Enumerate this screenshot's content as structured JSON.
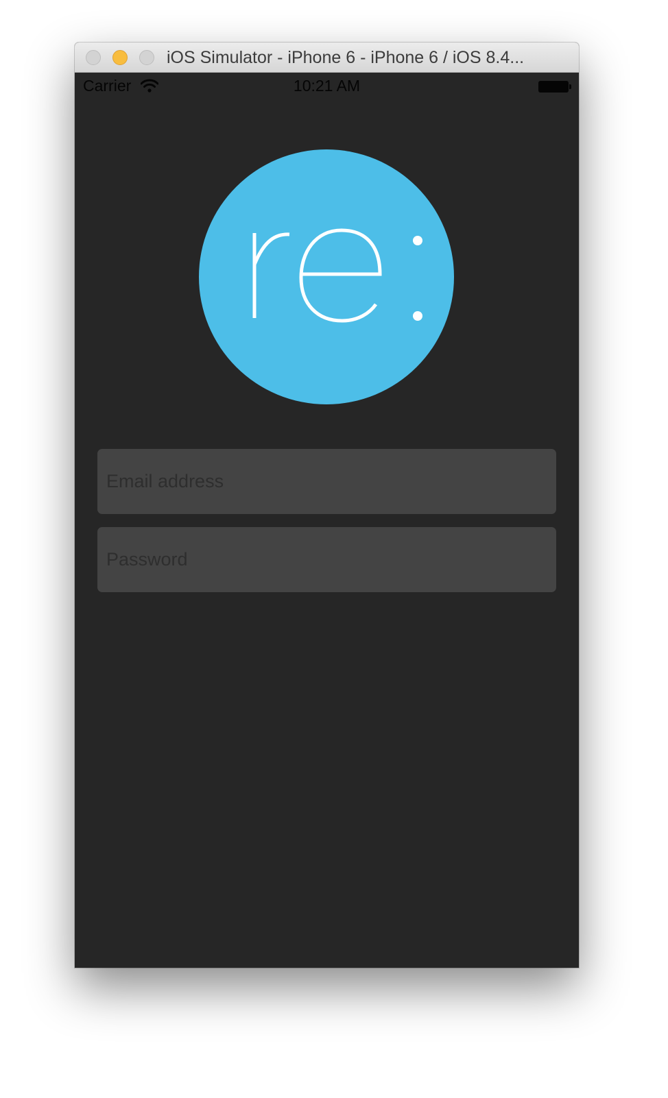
{
  "window": {
    "title": "iOS Simulator - iPhone 6 - iPhone 6 / iOS 8.4..."
  },
  "status_bar": {
    "carrier": "Carrier",
    "time": "10:21 AM",
    "icons": [
      "wifi-icon",
      "battery-icon"
    ]
  },
  "logo": {
    "text": "re:",
    "icon": "app-logo",
    "color": "#4dbee8"
  },
  "form": {
    "email": {
      "placeholder": "Email address",
      "value": ""
    },
    "password": {
      "placeholder": "Password",
      "value": ""
    }
  },
  "colors": {
    "background": "#262626",
    "field": "#444444",
    "accent": "#4dbee8"
  }
}
